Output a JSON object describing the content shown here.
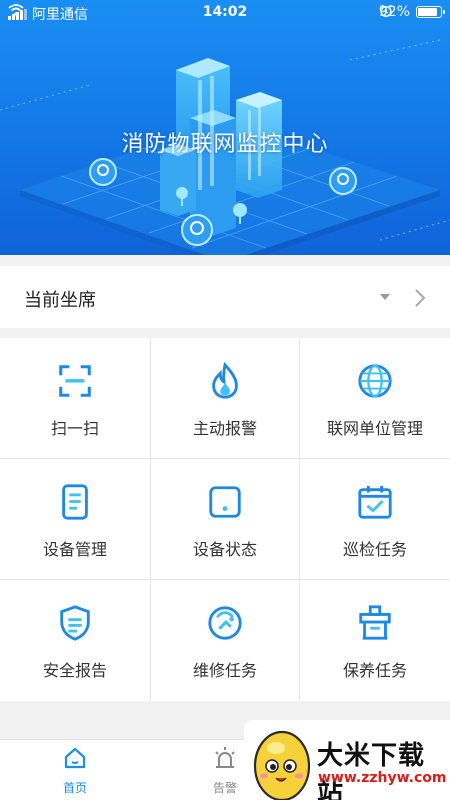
{
  "status_bar": {
    "carrier": "阿里通信",
    "time": "14:02",
    "battery": "92%",
    "battery_level": 0.92
  },
  "hero": {
    "title": "消防物联网监控中心"
  },
  "seat": {
    "label": "当前坐席"
  },
  "grid": {
    "items": [
      {
        "label": "扫一扫",
        "icon": "scan-icon"
      },
      {
        "label": "主动报警",
        "icon": "flame-icon"
      },
      {
        "label": "联网单位管理",
        "icon": "globe-icon"
      },
      {
        "label": "设备管理",
        "icon": "document-icon"
      },
      {
        "label": "设备状态",
        "icon": "device-status-icon"
      },
      {
        "label": "巡检任务",
        "icon": "calendar-check-icon"
      },
      {
        "label": "安全报告",
        "icon": "shield-icon"
      },
      {
        "label": "维修任务",
        "icon": "repair-icon"
      },
      {
        "label": "保养任务",
        "icon": "maintenance-icon"
      }
    ]
  },
  "tabbar": {
    "tabs": [
      {
        "label": "首页",
        "icon": "home-icon",
        "active": true
      },
      {
        "label": "告警",
        "icon": "alarm-light-icon",
        "active": false
      }
    ]
  },
  "watermark": {
    "name": "大米下载站",
    "url": "www.zzhyw.com"
  },
  "colors": {
    "accent": "#1a8ef2",
    "icon_blue": "#1e88e5",
    "tab_active": "#1a8ef2",
    "tab_inactive": "#888888",
    "watermark_url": "#d91e18"
  }
}
